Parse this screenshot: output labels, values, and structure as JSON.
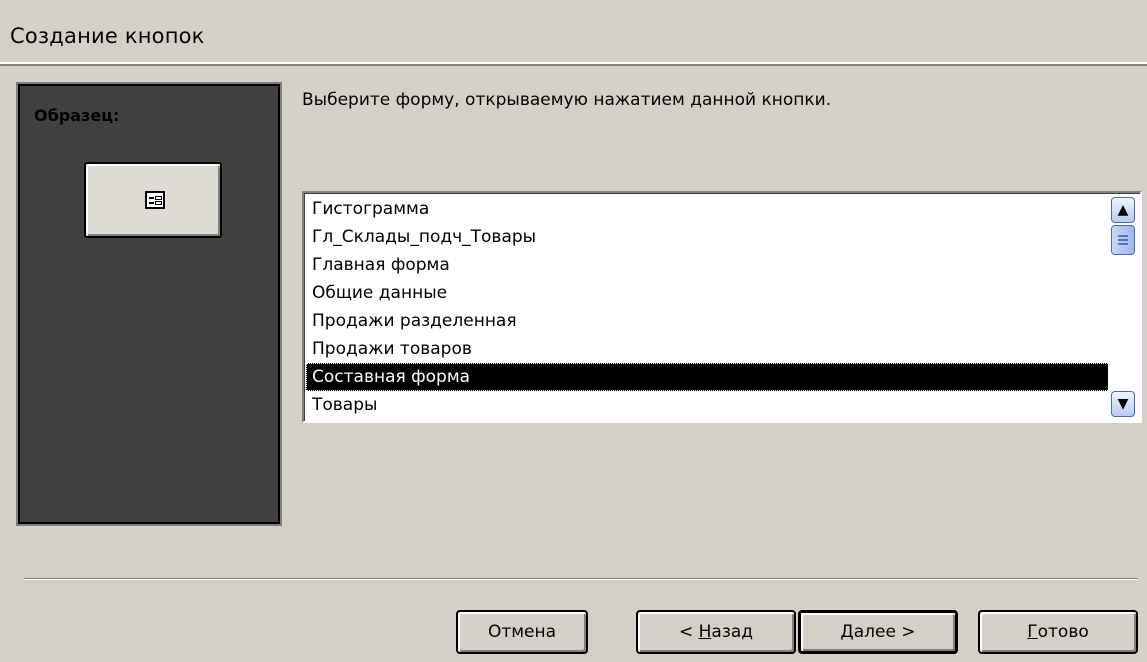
{
  "window": {
    "title": "Создание кнопок"
  },
  "sample": {
    "label": "Образец:",
    "button_icon": "form-icon"
  },
  "instruction": "Выберите форму, открываемую нажатием данной кнопки.",
  "forms_list": {
    "items": [
      "Гистограмма",
      "Гл_Склады_подч_Товары",
      "Главная форма",
      "Общие данные",
      "Продажи разделенная",
      "Продажи товаров",
      "Составная форма",
      "Товары"
    ],
    "selected": "Составная форма"
  },
  "buttons": {
    "cancel": "Отмена",
    "back_prefix": "< ",
    "back_accel": "Н",
    "back_rest": "азад",
    "next_accel": "Д",
    "next_rest": "алее >",
    "finish_accel": "Г",
    "finish_rest": "отово"
  },
  "colors": {
    "dialog_bg": "#d4d0c8",
    "sample_bg": "#404040",
    "selection_bg": "#000000",
    "selection_fg": "#ffffff"
  }
}
